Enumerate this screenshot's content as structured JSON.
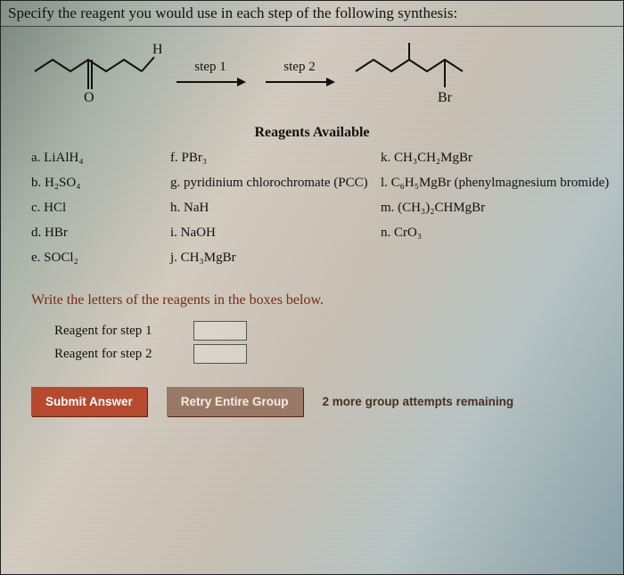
{
  "question": "Specify the reagent you would use in each step of the following synthesis:",
  "steps": {
    "step1_label": "step 1",
    "step2_label": "step 2",
    "start_label_top": "H",
    "start_label_bottom": "O",
    "product_label": "Br"
  },
  "reagents_title": "Reagents Available",
  "reagents": {
    "col1": [
      "a. LiAlH₄",
      "b. H₂SO₄",
      "c. HCl",
      "d. HBr",
      "e. SOCl₂"
    ],
    "col2": [
      "f. PBr₃",
      "g. pyridinium chlorochromate (PCC)",
      "h. NaH",
      "i. NaOH",
      "j. CH₃MgBr"
    ],
    "col3": [
      "k. CH₃CH₂MgBr",
      "l. C₆H₅MgBr (phenylmagnesium bromide)",
      "m. (CH₃)₂CHMgBr",
      "n. CrO₃",
      ""
    ]
  },
  "write_instruction": "Write the letters of the reagents in the boxes below.",
  "answer_labels": {
    "step1": "Reagent for step 1",
    "step2": "Reagent for step 2"
  },
  "answer_values": {
    "step1": "",
    "step2": ""
  },
  "buttons": {
    "submit": "Submit Answer",
    "retry": "Retry Entire Group"
  },
  "attempts_text": "2 more group attempts remaining"
}
